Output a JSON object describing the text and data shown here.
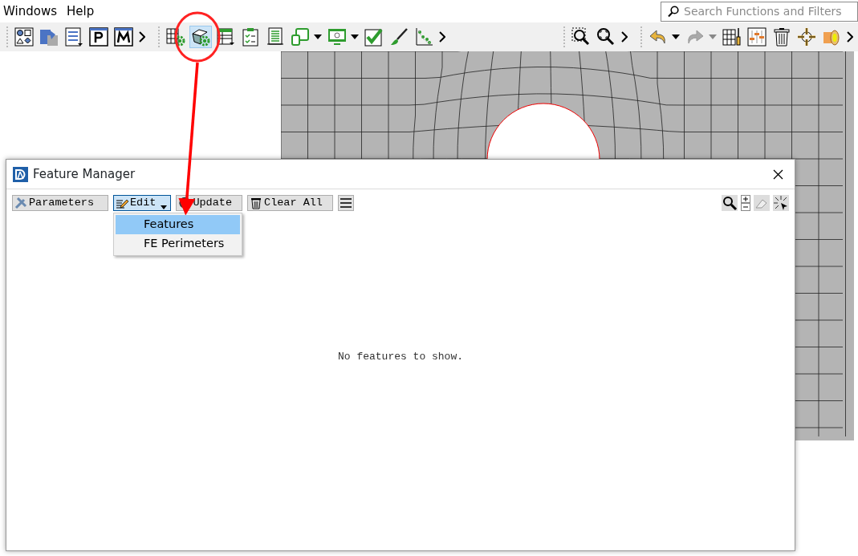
{
  "menubar": {
    "items": [
      "Windows",
      "Help"
    ]
  },
  "search": {
    "placeholder": "Search Functions and Filters"
  },
  "toolbar": {
    "groups": [
      [
        {
          "kind": "shapes",
          "selected": false,
          "dropdown": false
        },
        {
          "kind": "puzzle",
          "selected": false,
          "dropdown": false
        },
        {
          "kind": "list",
          "selected": false,
          "dropdown": false
        },
        {
          "kind": "pletter",
          "selected": false,
          "dropdown": false
        },
        {
          "kind": "mletter",
          "selected": false,
          "dropdown": false
        },
        {
          "kind": "more",
          "selected": false,
          "dropdown": false
        }
      ],
      [
        {
          "kind": "gridgear",
          "selected": false,
          "dropdown": false
        },
        {
          "kind": "cubegear",
          "selected": true,
          "dropdown": false
        },
        {
          "kind": "table",
          "selected": false,
          "dropdown": false
        },
        {
          "kind": "clipboard",
          "selected": false,
          "dropdown": false
        },
        {
          "kind": "document",
          "selected": false,
          "dropdown": false
        },
        {
          "kind": "devices",
          "selected": false,
          "dropdown": true
        },
        {
          "kind": "monitor",
          "selected": false,
          "dropdown": true
        },
        {
          "kind": "check",
          "selected": false,
          "dropdown": false
        },
        {
          "kind": "brush",
          "selected": false,
          "dropdown": false
        },
        {
          "kind": "plot",
          "selected": false,
          "dropdown": false
        },
        {
          "kind": "more",
          "selected": false,
          "dropdown": false
        }
      ],
      [
        {
          "kind": "zoombox",
          "selected": false,
          "dropdown": false
        },
        {
          "kind": "zoomfit",
          "selected": false,
          "dropdown": false
        },
        {
          "kind": "more",
          "selected": false,
          "dropdown": false
        }
      ],
      [
        {
          "kind": "undo",
          "selected": false,
          "dropdown": true
        },
        {
          "kind": "redo",
          "selected": false,
          "dropdown": true
        },
        {
          "kind": "gridtool",
          "selected": false,
          "dropdown": false
        },
        {
          "kind": "sliders",
          "selected": false,
          "dropdown": false
        },
        {
          "kind": "trash",
          "selected": false,
          "dropdown": false
        },
        {
          "kind": "target",
          "selected": false,
          "dropdown": false
        },
        {
          "kind": "cylinder",
          "selected": false,
          "dropdown": false
        },
        {
          "kind": "more",
          "selected": false,
          "dropdown": false
        }
      ]
    ]
  },
  "dialog": {
    "title": "Feature Manager",
    "buttons": [
      {
        "kind": "tools",
        "label": "Parameters",
        "pressed": false
      },
      {
        "kind": "edit",
        "label": "Edit",
        "pressed": true
      },
      {
        "kind": "update",
        "label": "Update",
        "pressed": false
      },
      {
        "kind": "trash",
        "label": "Clear All",
        "pressed": false
      }
    ],
    "menu": {
      "items": [
        {
          "label": "Features",
          "selected": true
        },
        {
          "label": "FE Perimeters",
          "selected": false
        }
      ]
    },
    "message": "No features to show."
  }
}
